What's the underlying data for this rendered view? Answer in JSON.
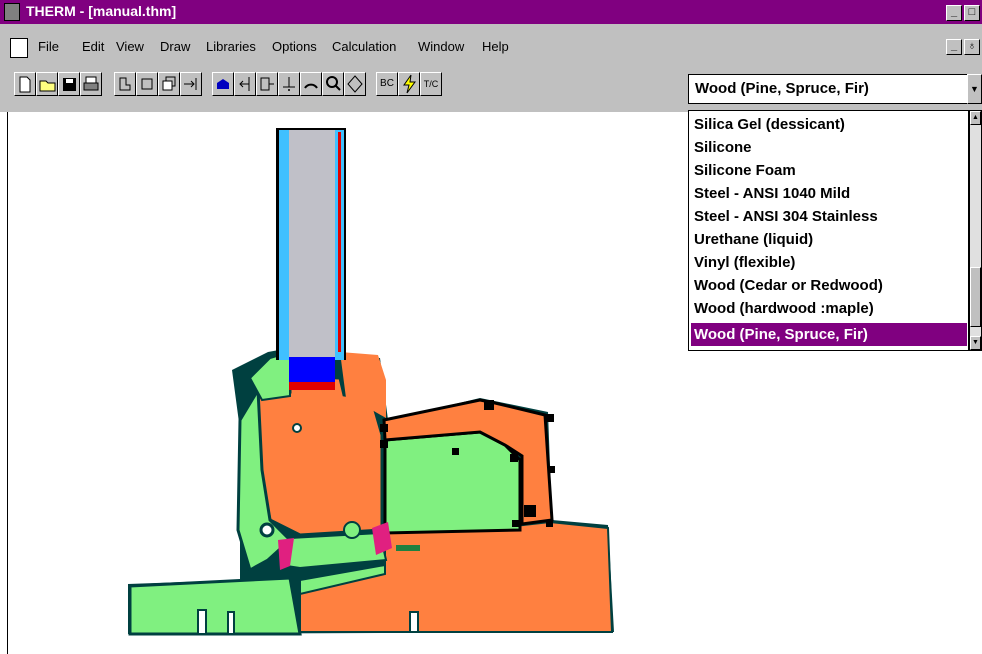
{
  "window": {
    "title": "THERM - [manual.thm]",
    "minimize": "_",
    "maximize": "□"
  },
  "menubar": {
    "items": [
      "File",
      "Edit",
      "View",
      "Draw",
      "Libraries",
      "Options",
      "Calculation",
      "Window",
      "Help"
    ],
    "mdi_minimize": "_",
    "mdi_restore": "♁"
  },
  "toolbar": {
    "buttons": [
      "new-file",
      "open-folder",
      "save-disk",
      "print",
      "draw-polygon",
      "draw-rectangle",
      "draw-fill-void",
      "draw-point",
      "boundary",
      "locate",
      "insert",
      "snap",
      "rotate",
      "zoom",
      "flip",
      "bc",
      "calculate",
      "tc"
    ],
    "material_selected": "Wood (Pine, Spruce, Fir)",
    "bc_label": "BC",
    "tc_label": "T/C"
  },
  "material_dropdown": {
    "options": [
      "Silica Gel (dessicant)",
      "Silicone",
      "Silicone Foam",
      "Steel - ANSI 1040 Mild",
      "Steel - ANSI 304 Stainless",
      "Urethane (liquid)",
      "Vinyl (flexible)",
      "Wood (Cedar or Redwood)",
      "Wood (hardwood :maple)",
      "Wood (Pine, Spruce, Fir)"
    ],
    "selected_index": 9
  },
  "colors": {
    "title_bar": "#800080",
    "wood": "#ff8040",
    "vinyl": "#80f080",
    "glass": "#c0c0c8",
    "glass_edge": "#40c0ff",
    "spacer": "#0000ff",
    "sealant": "#e00000",
    "gasket": "#e02080"
  }
}
